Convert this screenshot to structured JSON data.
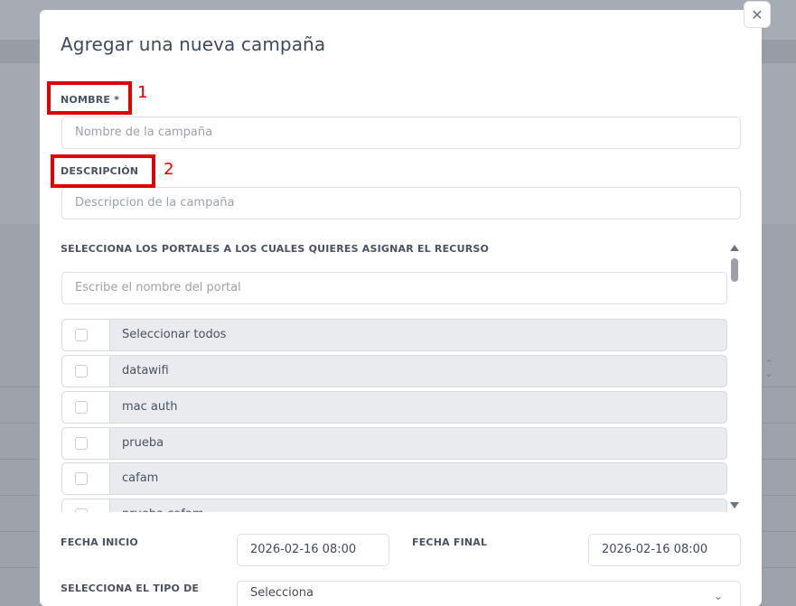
{
  "modal": {
    "title": "Agregar una nueva campaña",
    "close_icon": "close-icon"
  },
  "fields": {
    "name": {
      "label": "NOMBRE *",
      "placeholder": "Nombre de la campaña"
    },
    "description": {
      "label": "DESCRIPCIÓN",
      "placeholder": "Descripcion de la campaña"
    }
  },
  "annotations": [
    "1",
    "2"
  ],
  "portals": {
    "label": "SELECCIONA LOS PORTALES A LOS CUALES QUIERES ASIGNAR EL RECURSO",
    "search_placeholder": "Escribe el nombre del portal",
    "items": [
      {
        "label": "Seleccionar todos",
        "checked": false
      },
      {
        "label": "datawifi",
        "checked": false
      },
      {
        "label": "mac auth",
        "checked": false
      },
      {
        "label": "prueba",
        "checked": false
      },
      {
        "label": "cafam",
        "checked": false
      },
      {
        "label": "prueba cafam",
        "checked": false
      }
    ]
  },
  "dates": {
    "start": {
      "label": "FECHA INICIO",
      "value": "2026-02-16 08:00"
    },
    "end": {
      "label": "FECHA FINAL",
      "value": "2026-02-16 08:00"
    }
  },
  "type_select": {
    "label": "SELECCIONA EL TIPO DE",
    "value": "Selecciona"
  },
  "colors": {
    "annotation": "#e10000",
    "overlay": "#9ea3ab",
    "field_bg": "#e9ebee"
  }
}
